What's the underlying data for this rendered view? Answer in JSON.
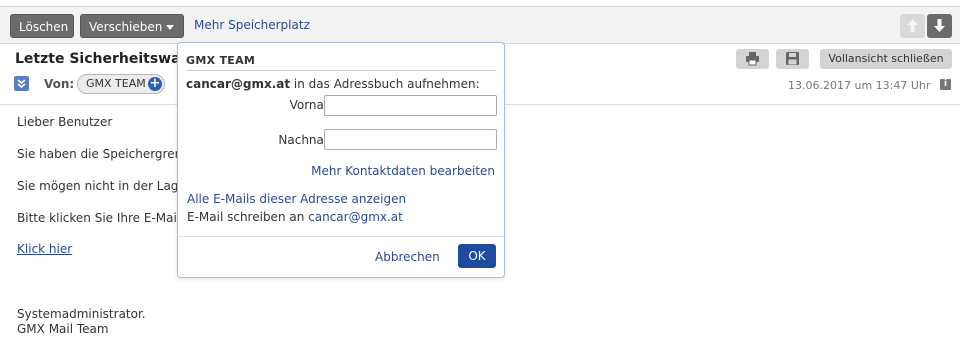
{
  "toolbar": {
    "delete_label": "Löschen",
    "move_label": "Verschieben",
    "storage_link": "Mehr Speicherplatz",
    "nav_up_icon": "arrow-up-icon",
    "nav_down_icon": "arrow-down-icon"
  },
  "header": {
    "subject": "Letzte Sicherheitswarnung",
    "from_label": "Von:",
    "sender": "GMX TEAM",
    "print_icon": "printer-icon",
    "save_icon": "floppy-disk-icon",
    "close_full_label": "Vollansicht schließen",
    "date": "13.06.2017 um 13:47 Uhr",
    "info_icon": "i"
  },
  "body": {
    "greeting": "Lieber Benutzer",
    "line2": "Sie haben die Speichergrenze",
    "line3": "Sie mögen nicht in der Lage",
    "line4": "Bitte klicken Sie Ihre E-Mail",
    "link": "Klick hier",
    "sig1": "Systemadministrator.",
    "sig2": "GMX Mail Team"
  },
  "popover": {
    "title": "GMX TEAM",
    "add_email": "cancar@gmx.at",
    "add_suffix": " in das Adressbuch aufnehmen:",
    "firstname_label": "Vorname:",
    "firstname_value": "",
    "lastname_label": "Nachname:",
    "lastname_value": "",
    "more_contact": "Mehr Kontaktdaten bearbeiten",
    "all_mails": "Alle E-Mails dieser Adresse anzeigen",
    "write_prefix": "E-Mail schreiben an ",
    "write_addr": "cancar@gmx.at",
    "cancel_label": "Abbrechen",
    "ok_label": "OK"
  },
  "colors": {
    "accent": "#1e4b9c",
    "link": "#2c4a8f",
    "button_dark": "#6b6b6b"
  }
}
